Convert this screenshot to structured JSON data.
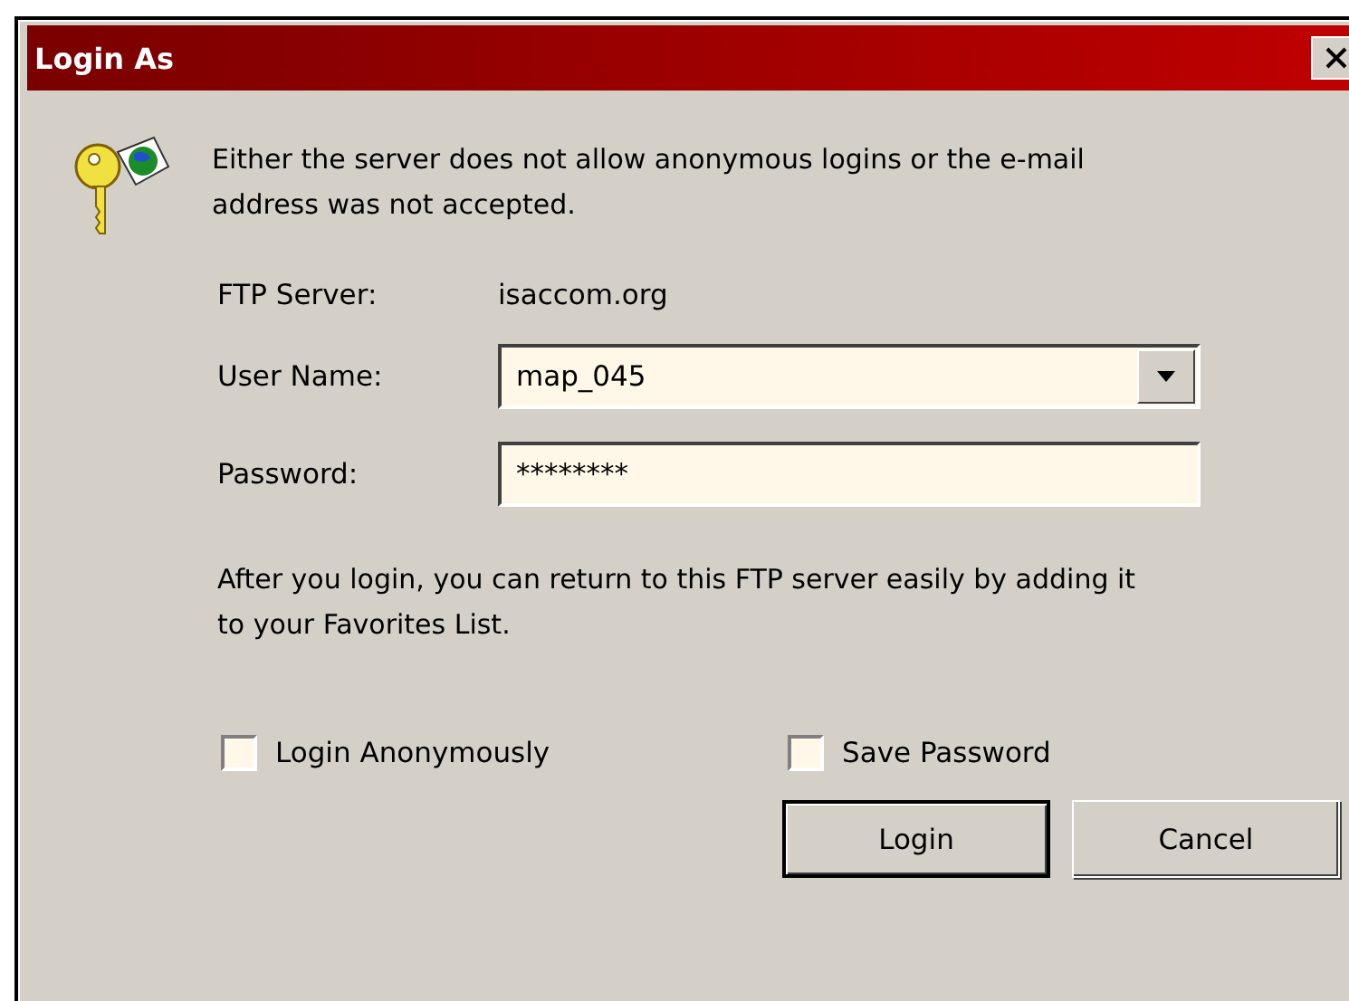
{
  "window": {
    "title": "Login As"
  },
  "message": "Either the server does not allow anonymous logins or the e-mail address was not accepted.",
  "server": {
    "label": "FTP Server:",
    "value": "isaccom.org"
  },
  "username": {
    "label": "User Name:",
    "value": "map_045"
  },
  "password": {
    "label": "Password:",
    "value": "********"
  },
  "info": "After you login, you can return to this FTP server easily by adding it to your Favorites List.",
  "options": [
    {
      "label": "Login Anonymously",
      "checked": false
    },
    {
      "label": "Save Password",
      "checked": false
    }
  ],
  "buttons": [
    {
      "label": "Login",
      "default": true
    },
    {
      "label": "Cancel",
      "default": false
    }
  ]
}
